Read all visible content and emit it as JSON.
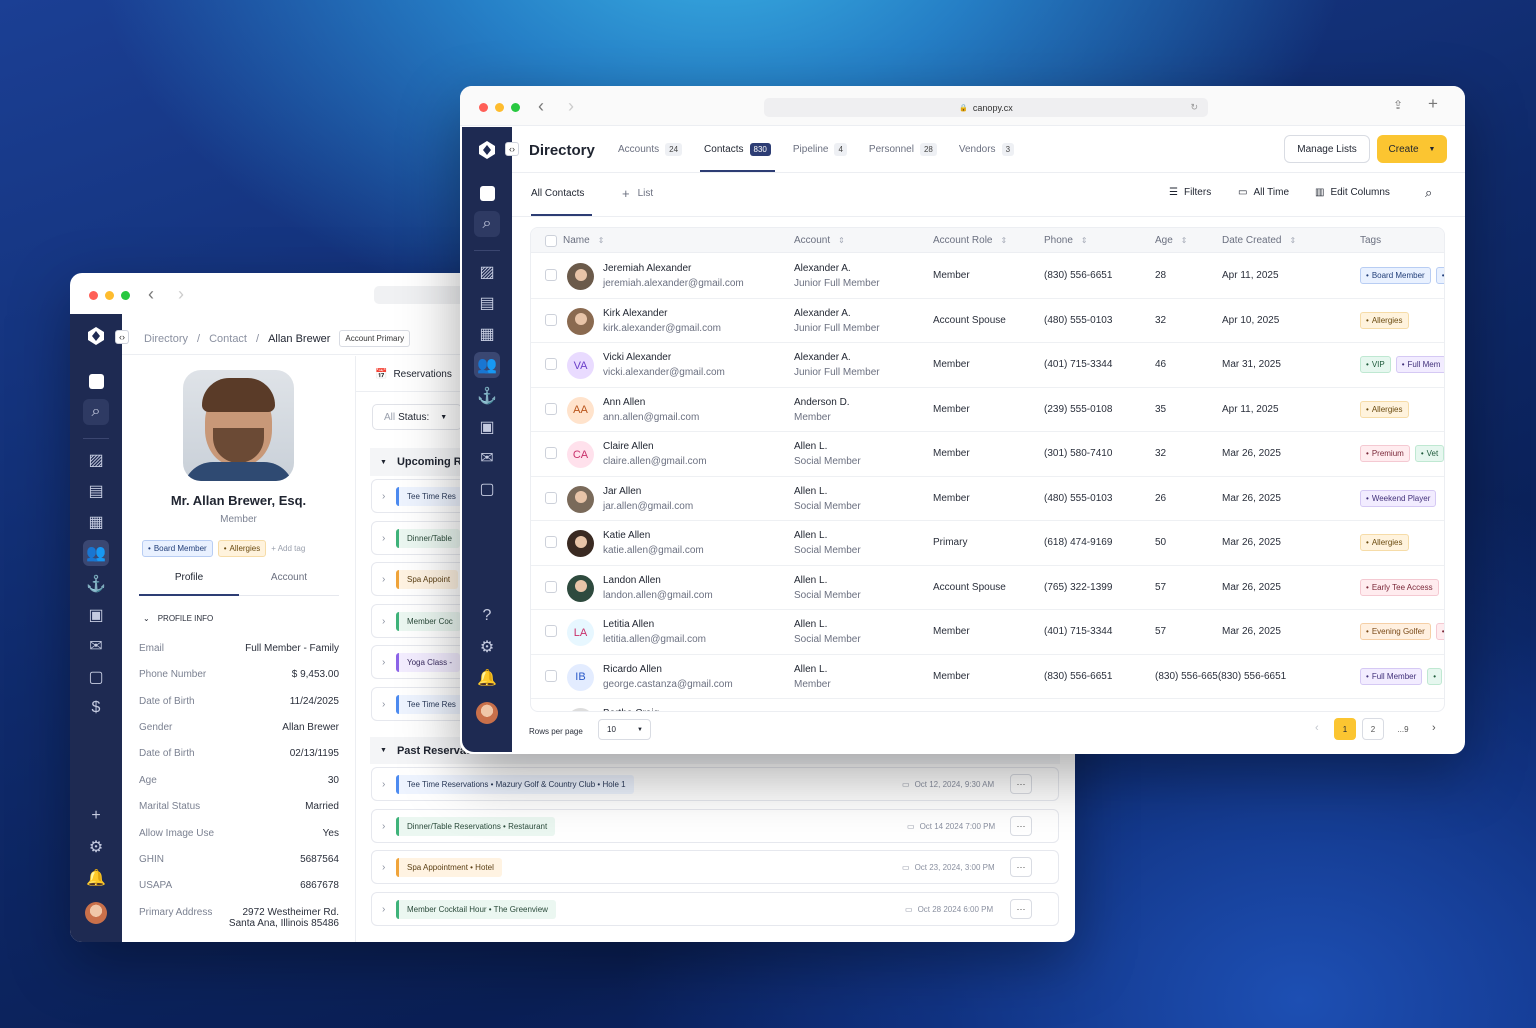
{
  "back": {
    "crumbs": [
      "Directory",
      "/",
      "Contact",
      "/",
      "Allan Brewer"
    ],
    "crumb_chip": "Account Primary",
    "profile": {
      "name": "Mr. Allan Brewer, Esq.",
      "role": "Member",
      "tags": [
        "Board Member",
        "Allergies"
      ],
      "add_tag": "+ Add tag"
    },
    "tabs": [
      "Profile",
      "Account"
    ],
    "section": "PROFILE INFO",
    "info": [
      {
        "label": "Email",
        "value": "Full Member - Family"
      },
      {
        "label": "Phone Number",
        "value": "$ 9,453.00"
      },
      {
        "label": "Date of Birth",
        "value": "11/24/2025"
      },
      {
        "label": "Gender",
        "value": "Allan Brewer"
      },
      {
        "label": "Date of Birth",
        "value": "02/13/1195"
      },
      {
        "label": "Age",
        "value": "30"
      },
      {
        "label": "Marital Status",
        "value": "Married"
      },
      {
        "label": "Allow Image Use",
        "value": "Yes"
      },
      {
        "label": "GHIN",
        "value": "5687564"
      },
      {
        "label": "USAPA",
        "value": "6867678"
      },
      {
        "label": "Primary Address",
        "value": "2972 Westheimer Rd.",
        "value2": "Santa Ana, Illinois 85486"
      }
    ],
    "reservations_tab": "Reservations",
    "status_filter_label": "All",
    "status_filter_value": "Status:",
    "upcoming_title": "Upcoming R",
    "upcoming": [
      "Tee Time Res",
      "Dinner/Table",
      "Spa Appoint",
      "Member Coc",
      "Yoga Class -",
      "Tee Time Res"
    ],
    "past_title": "Past Reservat",
    "past": [
      {
        "label": "Tee Time Reservations • Mazury Golf & Country Club • Hole 1",
        "date": "Oct 12, 2024, 9:30 AM"
      },
      {
        "label": "Dinner/Table Reservations • Restaurant",
        "date": "Oct 14 2024 7:00 PM"
      },
      {
        "label": "Spa Appointment • Hotel",
        "date": "Oct 23, 2024, 3:00 PM"
      },
      {
        "label": "Member Cocktail Hour • The Greenview",
        "date": "Oct 28 2024 6:00 PM"
      }
    ],
    "more": "···"
  },
  "front": {
    "url": "canopy.cx",
    "title": "Directory",
    "tabs": [
      {
        "label": "Accounts",
        "count": "24"
      },
      {
        "label": "Contacts",
        "count": "830"
      },
      {
        "label": "Pipeline",
        "count": "4"
      },
      {
        "label": "Personnel",
        "count": "28"
      },
      {
        "label": "Vendors",
        "count": "3"
      }
    ],
    "manage_lists": "Manage Lists",
    "create": "Create",
    "subtabs": {
      "all": "All Contacts",
      "list": "List"
    },
    "toolbar": {
      "filters": "Filters",
      "time": "All Time",
      "columns": "Edit Columns"
    },
    "columns": [
      "Name",
      "Account",
      "Account Role",
      "Phone",
      "Age",
      "Date Created",
      "Tags"
    ],
    "rows": [
      {
        "name": "Jeremiah Alexander",
        "email": "jeremiah.alexander@gmail.com",
        "account": "Alexander A.",
        "acct_type": "Junior Full Member",
        "role": "Member",
        "phone": "(830) 556-6651",
        "age": "28",
        "date": "Apr 11, 2025",
        "tags": [
          [
            "Board Member",
            "blue"
          ],
          [
            "",
            "blue"
          ]
        ]
      },
      {
        "name": "Kirk Alexander",
        "email": "kirk.alexander@gmail.com",
        "account": "Alexander A.",
        "acct_type": "Junior Full Member",
        "role": "Account Spouse",
        "phone": "(480) 555-0103",
        "age": "32",
        "date": "Apr 10, 2025",
        "tags": [
          [
            "Allergies",
            "orange"
          ]
        ]
      },
      {
        "name": "Vicki Alexander",
        "email": "vicki.alexander@gmail.com",
        "account": "Alexander A.",
        "acct_type": "Junior Full Member",
        "role": "Member",
        "phone": "(401) 715-3344",
        "age": "46",
        "date": "Mar 31, 2025",
        "initials": "VA",
        "tags": [
          [
            "VIP",
            "green"
          ],
          [
            "Full Mem",
            "purple"
          ]
        ]
      },
      {
        "name": "Ann Allen",
        "email": "ann.allen@gmail.com",
        "account": "Anderson D.",
        "acct_type": "Member",
        "role": "Member",
        "phone": "(239) 555-0108",
        "age": "35",
        "date": "Apr 11, 2025",
        "initials": "AA",
        "tags": [
          [
            "Allergies",
            "orange"
          ]
        ]
      },
      {
        "name": "Claire Allen",
        "email": "claire.allen@gmail.com",
        "account": "Allen L.",
        "acct_type": "Social Member",
        "role": "Member",
        "phone": "(301) 580-7410",
        "age": "32",
        "date": "Mar 26, 2025",
        "initials": "CA",
        "tags": [
          [
            "Premium",
            "pink"
          ],
          [
            "Vet",
            "green"
          ]
        ]
      },
      {
        "name": "Jar Allen",
        "email": "jar.allen@gmail.com",
        "account": "Allen L.",
        "acct_type": "Social Member",
        "role": "Member",
        "phone": "(480) 555-0103",
        "age": "26",
        "date": "Mar 26, 2025",
        "tags": [
          [
            "Weekend Player",
            "purple"
          ]
        ]
      },
      {
        "name": "Katie Allen",
        "email": "katie.allen@gmail.com",
        "account": "Allen L.",
        "acct_type": "Social Member",
        "role": "Primary",
        "phone": "(618) 474-9169",
        "age": "50",
        "date": "Mar 26, 2025",
        "tags": [
          [
            "Allergies",
            "orange"
          ]
        ]
      },
      {
        "name": "Landon Allen",
        "email": "landon.allen@gmail.com",
        "account": "Allen L.",
        "acct_type": "Social Member",
        "role": "Account Spouse",
        "phone": "(765) 322-1399",
        "age": "57",
        "date": "Mar 26, 2025",
        "tags": [
          [
            "Early Tee Access",
            "pink"
          ]
        ]
      },
      {
        "name": "Letitia Allen",
        "email": "letitia.allen@gmail.com",
        "account": "Allen L.",
        "acct_type": "Social Member",
        "role": "Member",
        "phone": "(401) 715-3344",
        "age": "57",
        "date": "Mar 26, 2025",
        "initials": "LA",
        "tags": [
          [
            "Evening Golfer",
            "amber"
          ],
          [
            "",
            "pink"
          ]
        ]
      },
      {
        "name": "Ricardo Allen",
        "email": "george.castanza@gmail.com",
        "account": "Allen L.",
        "acct_type": "Member",
        "role": "Member",
        "phone": "(830) 556-6651",
        "age": "(830) 556-665(830) 556-6651",
        "date": "",
        "initials": "IB",
        "tags": [
          [
            "Full Member",
            "purple"
          ],
          [
            "",
            "green"
          ]
        ]
      },
      {
        "name": "Bertha Craig",
        "email": "",
        "account": "",
        "acct_type": "",
        "role": "",
        "phone": "",
        "age": "",
        "date": "",
        "tags": []
      }
    ],
    "rows_per_page_label": "Rows per page",
    "rows_per_page": "10",
    "pages": [
      "1",
      "2",
      "...9"
    ]
  }
}
